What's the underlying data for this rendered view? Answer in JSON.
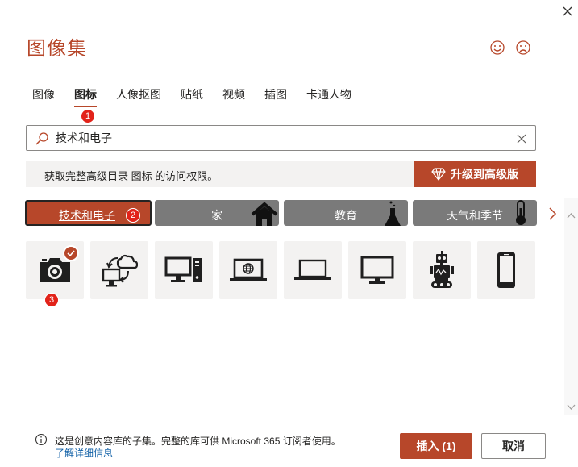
{
  "dialog": {
    "title": "图像集"
  },
  "tabs": [
    {
      "label": "图像"
    },
    {
      "label": "图标"
    },
    {
      "label": "人像抠图"
    },
    {
      "label": "贴纸"
    },
    {
      "label": "视频"
    },
    {
      "label": "插图"
    },
    {
      "label": "卡通人物"
    }
  ],
  "active_tab": "图标",
  "search": {
    "value": "技术和电子"
  },
  "banner": {
    "text": "获取完整高级目录 图标 的访问权限。",
    "upgrade_label": "升级到高级版"
  },
  "categories": [
    {
      "label": "技术和电子",
      "icon": "none"
    },
    {
      "label": "家",
      "icon": "house-icon"
    },
    {
      "label": "教育",
      "icon": "flask-icon"
    },
    {
      "label": "天气和季节",
      "icon": "thermometer-icon"
    }
  ],
  "active_category": "技术和电子",
  "icons": [
    {
      "icon": "camera-icon",
      "selected": true
    },
    {
      "icon": "cloud-sync-computer-icon",
      "selected": false
    },
    {
      "icon": "desktop-tower-icon",
      "selected": false
    },
    {
      "icon": "laptop-globe-icon",
      "selected": false
    },
    {
      "icon": "laptop-icon",
      "selected": false
    },
    {
      "icon": "monitor-icon",
      "selected": false
    },
    {
      "icon": "robot-icon",
      "selected": false
    },
    {
      "icon": "smartphone-icon",
      "selected": false
    }
  ],
  "step_badges": [
    "1",
    "2",
    "3"
  ],
  "footer": {
    "info_text": "这是创意内容库的子集。完整的库可供 Microsoft 365 订阅者使用。",
    "link_text": "了解详细信息",
    "insert_label": "插入 (1)",
    "cancel_label": "取消"
  },
  "colors": {
    "accent": "#b7472a",
    "category_bg": "#7a7a7a",
    "tile_bg": "#f3f2f1",
    "badge": "#e2231a",
    "link": "#0f5fa6"
  }
}
